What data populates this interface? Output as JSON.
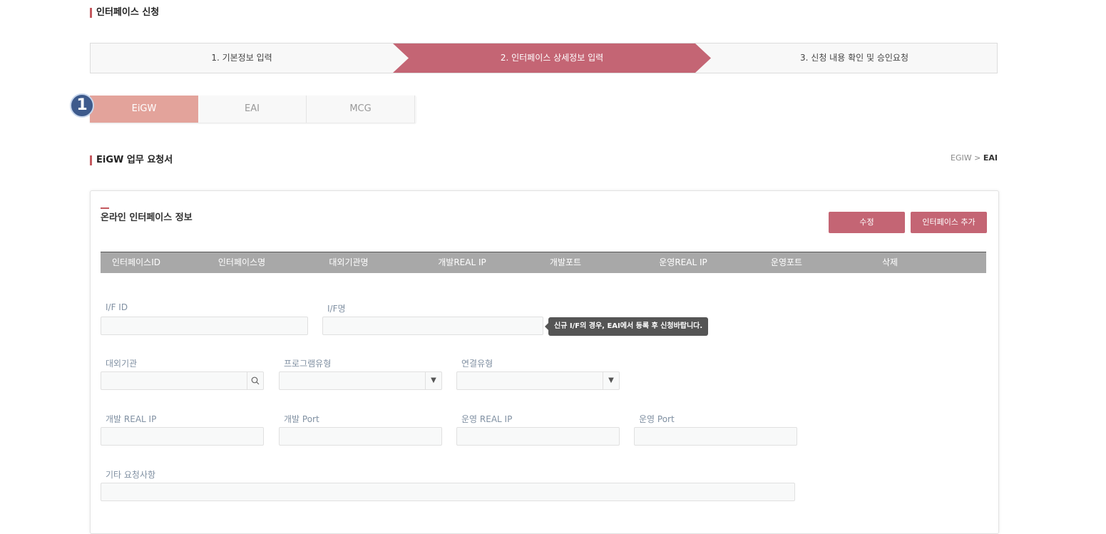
{
  "page_title": "인터페이스 신청",
  "steps": [
    "1. 기본정보 입력",
    "2. 인터페이스 상세정보 입력",
    "3. 신청 내용 확인 및 승인요청"
  ],
  "badge": "1",
  "tabs": [
    "EiGW",
    "EAI",
    "MCG"
  ],
  "section_title": "EiGW 업무 요청서",
  "breadcrumb": {
    "first": "EGIW",
    "sep": ">",
    "current": "EAI"
  },
  "card": {
    "title": "온라인 인터페이스 정보",
    "edit_button": "수정",
    "add_button": "인터페이스 추가",
    "columns": [
      "인터페이스ID",
      "인터페이스명",
      "대외기관명",
      "개발REAL IP",
      "개발포트",
      "운영REAL IP",
      "운영포트",
      "삭제"
    ]
  },
  "form": {
    "if_id_label": "I/F ID",
    "if_name_label": "I/F명",
    "tooltip": "신규 I/F의 경우, EAI에서 등록 후 신청바랍니다.",
    "agency_label": "대외기관",
    "program_type_label": "프로그램유형",
    "connection_type_label": "연결유형",
    "dev_ip_label": "개발 REAL IP",
    "dev_port_label": "개발 Port",
    "prod_ip_label": "운영 REAL IP",
    "prod_port_label": "운영 Port",
    "etc_label": "기타 요청사항"
  },
  "icons": {
    "search": "search-icon",
    "dropdown": "dropdown-arrow-icon"
  },
  "colors": {
    "accent": "#c46574",
    "active_tab": "#e3a39b",
    "badge": "#3d5a8c",
    "table_header": "#a8a8a8"
  }
}
